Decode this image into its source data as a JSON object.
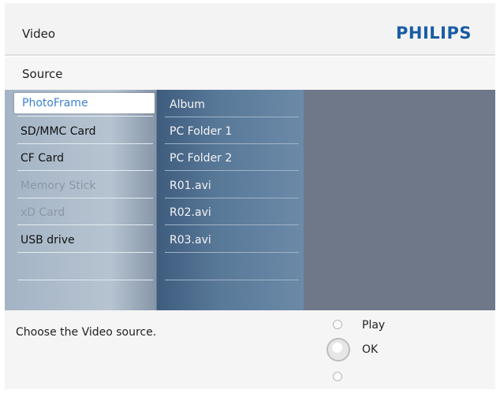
{
  "header": {
    "title": "Video",
    "brand": "PHILIPS"
  },
  "subheader": {
    "title": "Source"
  },
  "sources": [
    {
      "label": "PhotoFrame",
      "state": "selected"
    },
    {
      "label": "SD/MMC Card",
      "state": "normal"
    },
    {
      "label": "CF Card",
      "state": "normal"
    },
    {
      "label": "Memory Stick",
      "state": "disabled"
    },
    {
      "label": "xD Card",
      "state": "disabled"
    },
    {
      "label": "USB drive",
      "state": "normal"
    }
  ],
  "contents": [
    {
      "label": "Album"
    },
    {
      "label": "PC Folder 1"
    },
    {
      "label": "PC Folder 2"
    },
    {
      "label": "R01.avi"
    },
    {
      "label": "R02.avi"
    },
    {
      "label": "R03.avi"
    }
  ],
  "footer": {
    "hint": "Choose the Video source.",
    "controls": {
      "play_label": "Play",
      "ok_label": "OK"
    }
  },
  "colors": {
    "brand": "#1a5ca3",
    "selected_text": "#3d7fd1",
    "panel_dark": "#6e7889"
  }
}
